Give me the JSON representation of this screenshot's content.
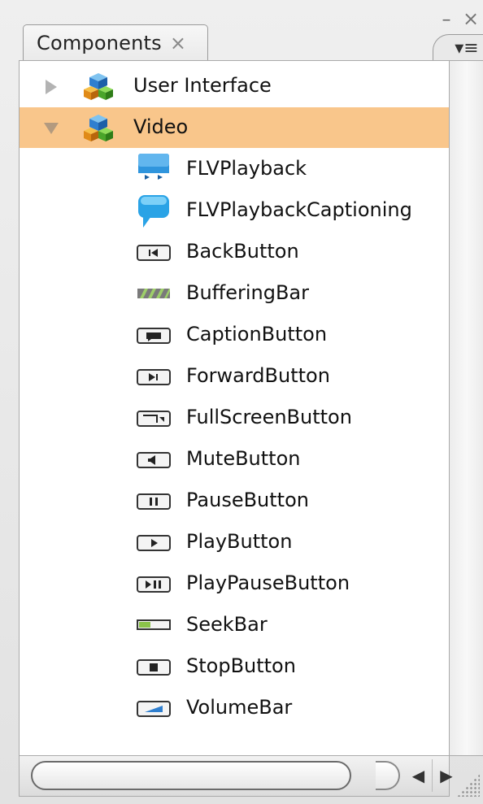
{
  "panel": {
    "tab_label": "Components",
    "tab_close_glyph": "×",
    "minimize_glyph": "–",
    "close_glyph": "×",
    "menu_glyph": "▾≡"
  },
  "colors": {
    "selection": "#f9c68b",
    "icon_blue": "#2f95dd"
  },
  "tree": {
    "folders": [
      {
        "label": "User Interface",
        "expanded": false,
        "icon": "package-cubes-icon"
      },
      {
        "label": "Video",
        "expanded": true,
        "selected": true,
        "icon": "package-cubes-icon"
      }
    ],
    "video_items": [
      {
        "label": "FLVPlayback",
        "icon": "flvplayback-icon"
      },
      {
        "label": "FLVPlaybackCaptioning",
        "icon": "speech-bubble-icon"
      },
      {
        "label": "BackButton",
        "icon": "back-button-icon"
      },
      {
        "label": "BufferingBar",
        "icon": "buffering-bar-icon"
      },
      {
        "label": "CaptionButton",
        "icon": "caption-button-icon"
      },
      {
        "label": "ForwardButton",
        "icon": "forward-button-icon"
      },
      {
        "label": "FullScreenButton",
        "icon": "fullscreen-button-icon"
      },
      {
        "label": "MuteButton",
        "icon": "mute-button-icon"
      },
      {
        "label": "PauseButton",
        "icon": "pause-button-icon"
      },
      {
        "label": "PlayButton",
        "icon": "play-button-icon"
      },
      {
        "label": "PlayPauseButton",
        "icon": "play-pause-button-icon"
      },
      {
        "label": "SeekBar",
        "icon": "seek-bar-icon"
      },
      {
        "label": "StopButton",
        "icon": "stop-button-icon"
      },
      {
        "label": "VolumeBar",
        "icon": "volume-bar-icon"
      }
    ]
  },
  "scrollbar": {
    "left_arrow": "◀",
    "right_arrow": "▶"
  }
}
